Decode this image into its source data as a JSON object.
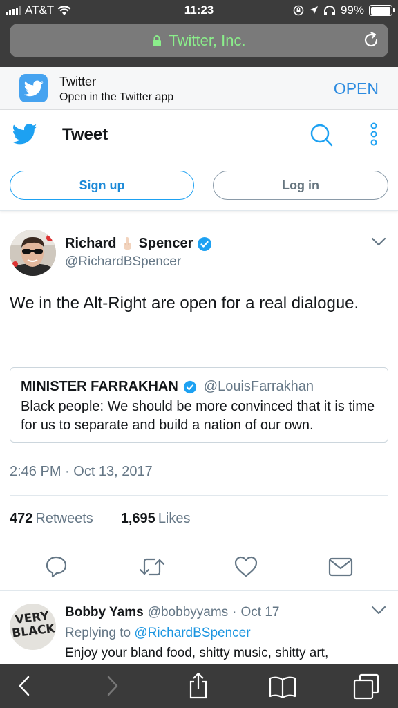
{
  "status_bar": {
    "carrier": "AT&T",
    "time": "11:23",
    "battery": "99%",
    "battery_level": 0.99
  },
  "browser": {
    "url_text": "Twitter, Inc.",
    "toolbar_icons": [
      "back-icon",
      "forward-icon",
      "share-icon",
      "bookmarks-icon",
      "tabs-icon"
    ]
  },
  "app_banner": {
    "app_name": "Twitter",
    "subtitle": "Open in the Twitter app",
    "open_label": "OPEN"
  },
  "header": {
    "title": "Tweet",
    "signup_label": "Sign up",
    "login_label": "Log in"
  },
  "tweet": {
    "name_first": "Richard",
    "name_last": "Spencer",
    "handle": "@RichardBSpencer",
    "text": "We in the Alt-Right are open for a real dialogue.",
    "quote": {
      "name": "MINISTER FARRAKHAN",
      "handle": "@LouisFarrakhan",
      "text": "Black people: We should be more convinced that it is time for us to separate and build a nation of our own."
    },
    "timestamp": "2:46 PM · Oct 13, 2017",
    "retweets_count": "472",
    "retweets_label": "Retweets",
    "likes_count": "1,695",
    "likes_label": "Likes",
    "actions": [
      "reply-icon",
      "retweet-icon",
      "like-icon",
      "message-icon"
    ]
  },
  "reply": {
    "name": "Bobby Yams",
    "handle": "@bobbyyams",
    "separator": "·",
    "date": "Oct 17",
    "replying_prefix": "Replying to",
    "replying_to": "@RichardBSpencer",
    "text": "Enjoy your bland food, shitty music, shitty art,",
    "avatar_text": "VERY BLACK"
  },
  "colors": {
    "twitter_blue": "#1da1f2",
    "link_blue": "#1b95e0",
    "secondary_text": "#657786",
    "url_green": "#8bee8b",
    "browser_chrome": "#3c3c3c"
  }
}
